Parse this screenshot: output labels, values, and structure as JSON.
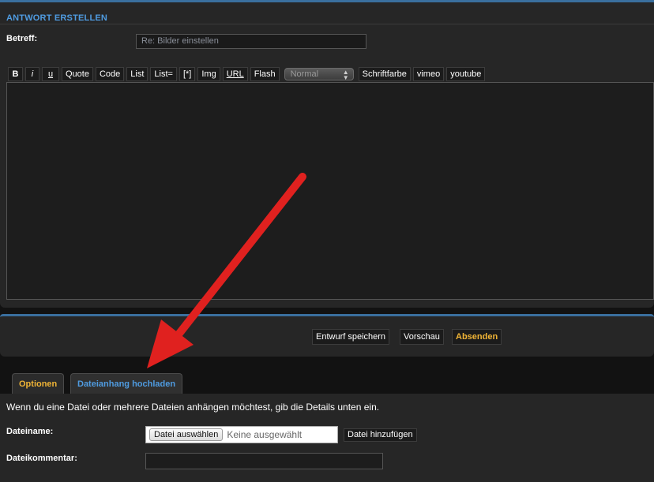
{
  "reply": {
    "title": "ANTWORT ERSTELLEN",
    "subject_label": "Betreff:",
    "subject_value": "Re: Bilder einstellen"
  },
  "toolbar": {
    "buttons": [
      "B",
      "i",
      "u",
      "Quote",
      "Code",
      "List",
      "List=",
      "[*]",
      "Img",
      "URL",
      "Flash",
      "Schriftfarbe",
      "vimeo",
      "youtube"
    ],
    "size_select": "Normal"
  },
  "message": {
    "value": ""
  },
  "actions": {
    "draft": "Entwurf speichern",
    "preview": "Vorschau",
    "submit": "Absenden"
  },
  "tabs": {
    "options": "Optionen",
    "upload": "Dateianhang hochladen",
    "active": "upload"
  },
  "upload": {
    "intro": "Wenn du eine Datei oder mehrere Dateien anhängen möchtest, gib die Details unten ein.",
    "filename_label": "Dateiname:",
    "choose_button": "Datei auswählen",
    "no_file": "Keine ausgewählt",
    "add_button": "Datei hinzufügen",
    "comment_label": "Dateikommentar:"
  },
  "colors": {
    "accent_blue": "#4f9be0",
    "accent_orange": "#f0b436",
    "annotation_red": "#e0211f"
  }
}
